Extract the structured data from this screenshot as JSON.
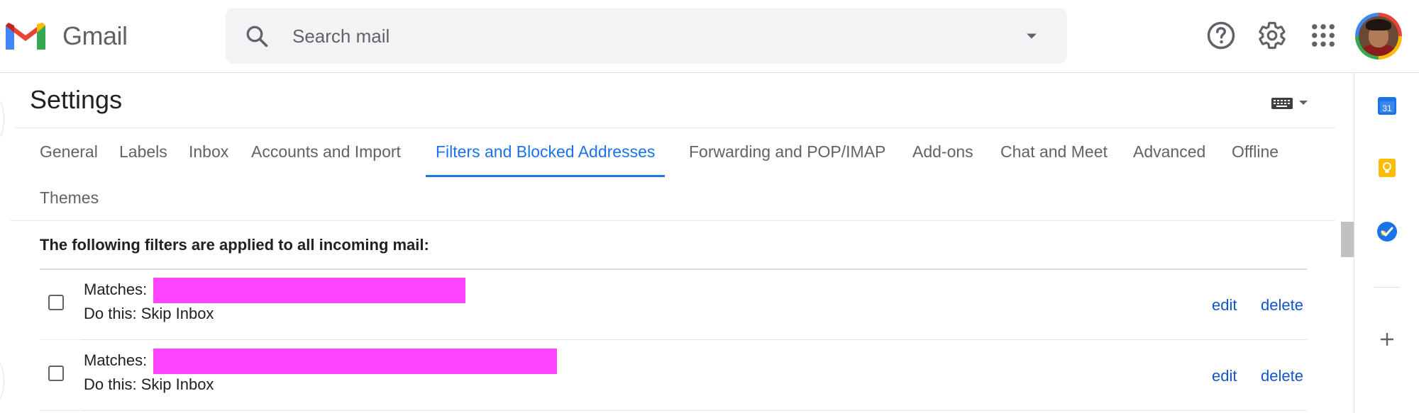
{
  "app": {
    "name": "Gmail"
  },
  "search": {
    "placeholder": "Search mail"
  },
  "header_icons": [
    "help-icon",
    "gear-icon",
    "apps-grid-icon",
    "avatar"
  ],
  "settings": {
    "title": "Settings",
    "tabs": [
      {
        "label": "General",
        "active": false
      },
      {
        "label": "Labels",
        "active": false
      },
      {
        "label": "Inbox",
        "active": false
      },
      {
        "label": "Accounts and Import",
        "active": false
      },
      {
        "label": "Filters and Blocked Addresses",
        "active": true
      },
      {
        "label": "Forwarding and POP/IMAP",
        "active": false
      },
      {
        "label": "Add-ons",
        "active": false
      },
      {
        "label": "Chat and Meet",
        "active": false
      },
      {
        "label": "Advanced",
        "active": false
      },
      {
        "label": "Offline",
        "active": false
      },
      {
        "label": "Themes",
        "active": false
      }
    ]
  },
  "filters": {
    "heading": "The following filters are applied to all incoming mail:",
    "items": [
      {
        "matches_label": "Matches:",
        "do_this": "Do this: Skip Inbox",
        "checked": false,
        "edit": "edit",
        "delete": "delete"
      },
      {
        "matches_label": "Matches:",
        "do_this": "Do this: Skip Inbox",
        "checked": false,
        "edit": "edit",
        "delete": "delete"
      }
    ]
  },
  "side_panel": {
    "icons": [
      "calendar-icon",
      "keep-icon",
      "tasks-icon",
      "add-icon"
    ],
    "calendar_day": "31"
  },
  "colors": {
    "accent": "#1a73e8",
    "link": "#1155cc",
    "redaction": "#ff44ff",
    "search_bg": "#f1f3f4"
  }
}
